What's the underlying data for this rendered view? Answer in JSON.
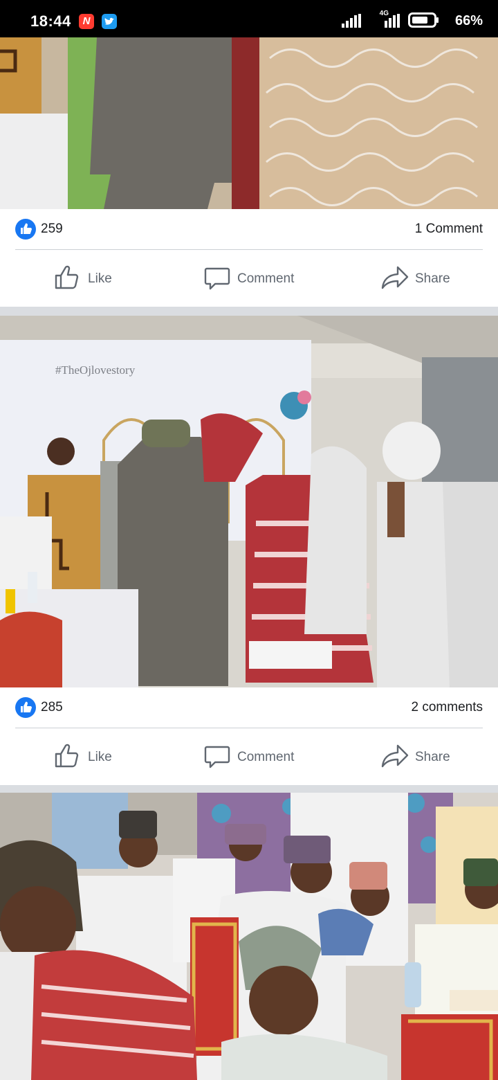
{
  "status_bar": {
    "time": "18:44",
    "network": "4G",
    "battery": "66%",
    "icons": [
      "notification-n-icon",
      "twitter-icon",
      "signal-icon",
      "battery-icon"
    ]
  },
  "posts": [
    {
      "likes": "259",
      "comments": "1 Comment",
      "actions": {
        "like": "Like",
        "comment": "Comment",
        "share": "Share"
      }
    },
    {
      "photo_text": "#TheOjlovestory",
      "likes": "285",
      "comments": "2 comments",
      "actions": {
        "like": "Like",
        "comment": "Comment",
        "share": "Share"
      }
    }
  ],
  "colors": {
    "like_blue": "#1877f2",
    "action_gray": "#606770",
    "feed_separator": "#dadde1"
  }
}
